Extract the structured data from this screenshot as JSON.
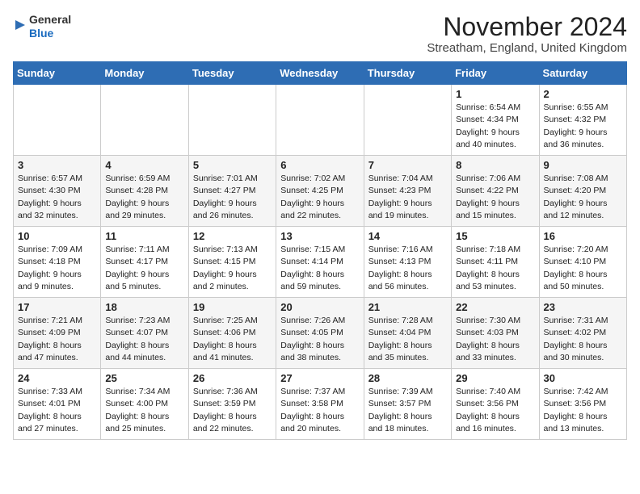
{
  "logo": {
    "line1": "General",
    "line2": "Blue"
  },
  "title": "November 2024",
  "location": "Streatham, England, United Kingdom",
  "headers": [
    "Sunday",
    "Monday",
    "Tuesday",
    "Wednesday",
    "Thursday",
    "Friday",
    "Saturday"
  ],
  "weeks": [
    [
      {
        "day": "",
        "info": ""
      },
      {
        "day": "",
        "info": ""
      },
      {
        "day": "",
        "info": ""
      },
      {
        "day": "",
        "info": ""
      },
      {
        "day": "",
        "info": ""
      },
      {
        "day": "1",
        "info": "Sunrise: 6:54 AM\nSunset: 4:34 PM\nDaylight: 9 hours\nand 40 minutes."
      },
      {
        "day": "2",
        "info": "Sunrise: 6:55 AM\nSunset: 4:32 PM\nDaylight: 9 hours\nand 36 minutes."
      }
    ],
    [
      {
        "day": "3",
        "info": "Sunrise: 6:57 AM\nSunset: 4:30 PM\nDaylight: 9 hours\nand 32 minutes."
      },
      {
        "day": "4",
        "info": "Sunrise: 6:59 AM\nSunset: 4:28 PM\nDaylight: 9 hours\nand 29 minutes."
      },
      {
        "day": "5",
        "info": "Sunrise: 7:01 AM\nSunset: 4:27 PM\nDaylight: 9 hours\nand 26 minutes."
      },
      {
        "day": "6",
        "info": "Sunrise: 7:02 AM\nSunset: 4:25 PM\nDaylight: 9 hours\nand 22 minutes."
      },
      {
        "day": "7",
        "info": "Sunrise: 7:04 AM\nSunset: 4:23 PM\nDaylight: 9 hours\nand 19 minutes."
      },
      {
        "day": "8",
        "info": "Sunrise: 7:06 AM\nSunset: 4:22 PM\nDaylight: 9 hours\nand 15 minutes."
      },
      {
        "day": "9",
        "info": "Sunrise: 7:08 AM\nSunset: 4:20 PM\nDaylight: 9 hours\nand 12 minutes."
      }
    ],
    [
      {
        "day": "10",
        "info": "Sunrise: 7:09 AM\nSunset: 4:18 PM\nDaylight: 9 hours\nand 9 minutes."
      },
      {
        "day": "11",
        "info": "Sunrise: 7:11 AM\nSunset: 4:17 PM\nDaylight: 9 hours\nand 5 minutes."
      },
      {
        "day": "12",
        "info": "Sunrise: 7:13 AM\nSunset: 4:15 PM\nDaylight: 9 hours\nand 2 minutes."
      },
      {
        "day": "13",
        "info": "Sunrise: 7:15 AM\nSunset: 4:14 PM\nDaylight: 8 hours\nand 59 minutes."
      },
      {
        "day": "14",
        "info": "Sunrise: 7:16 AM\nSunset: 4:13 PM\nDaylight: 8 hours\nand 56 minutes."
      },
      {
        "day": "15",
        "info": "Sunrise: 7:18 AM\nSunset: 4:11 PM\nDaylight: 8 hours\nand 53 minutes."
      },
      {
        "day": "16",
        "info": "Sunrise: 7:20 AM\nSunset: 4:10 PM\nDaylight: 8 hours\nand 50 minutes."
      }
    ],
    [
      {
        "day": "17",
        "info": "Sunrise: 7:21 AM\nSunset: 4:09 PM\nDaylight: 8 hours\nand 47 minutes."
      },
      {
        "day": "18",
        "info": "Sunrise: 7:23 AM\nSunset: 4:07 PM\nDaylight: 8 hours\nand 44 minutes."
      },
      {
        "day": "19",
        "info": "Sunrise: 7:25 AM\nSunset: 4:06 PM\nDaylight: 8 hours\nand 41 minutes."
      },
      {
        "day": "20",
        "info": "Sunrise: 7:26 AM\nSunset: 4:05 PM\nDaylight: 8 hours\nand 38 minutes."
      },
      {
        "day": "21",
        "info": "Sunrise: 7:28 AM\nSunset: 4:04 PM\nDaylight: 8 hours\nand 35 minutes."
      },
      {
        "day": "22",
        "info": "Sunrise: 7:30 AM\nSunset: 4:03 PM\nDaylight: 8 hours\nand 33 minutes."
      },
      {
        "day": "23",
        "info": "Sunrise: 7:31 AM\nSunset: 4:02 PM\nDaylight: 8 hours\nand 30 minutes."
      }
    ],
    [
      {
        "day": "24",
        "info": "Sunrise: 7:33 AM\nSunset: 4:01 PM\nDaylight: 8 hours\nand 27 minutes."
      },
      {
        "day": "25",
        "info": "Sunrise: 7:34 AM\nSunset: 4:00 PM\nDaylight: 8 hours\nand 25 minutes."
      },
      {
        "day": "26",
        "info": "Sunrise: 7:36 AM\nSunset: 3:59 PM\nDaylight: 8 hours\nand 22 minutes."
      },
      {
        "day": "27",
        "info": "Sunrise: 7:37 AM\nSunset: 3:58 PM\nDaylight: 8 hours\nand 20 minutes."
      },
      {
        "day": "28",
        "info": "Sunrise: 7:39 AM\nSunset: 3:57 PM\nDaylight: 8 hours\nand 18 minutes."
      },
      {
        "day": "29",
        "info": "Sunrise: 7:40 AM\nSunset: 3:56 PM\nDaylight: 8 hours\nand 16 minutes."
      },
      {
        "day": "30",
        "info": "Sunrise: 7:42 AM\nSunset: 3:56 PM\nDaylight: 8 hours\nand 13 minutes."
      }
    ]
  ]
}
